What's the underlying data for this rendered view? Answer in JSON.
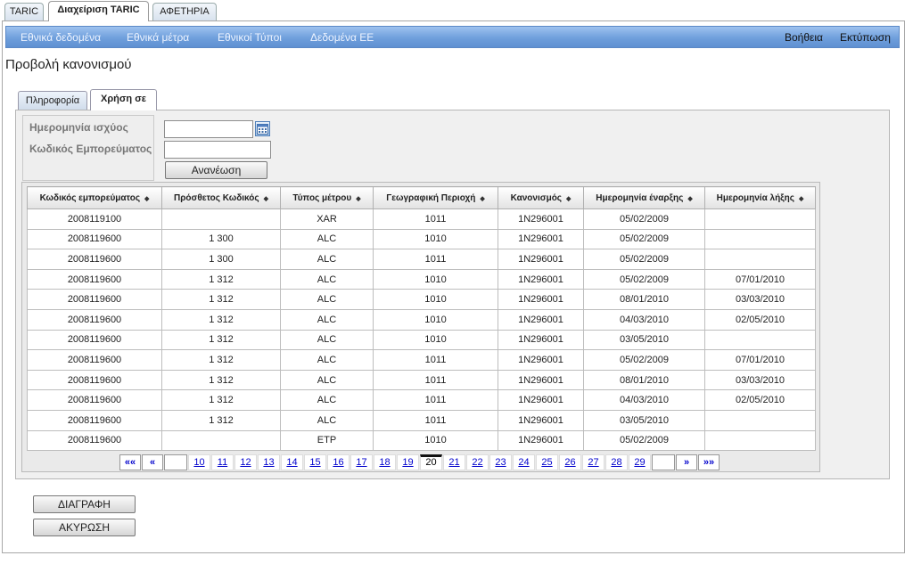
{
  "top_tabs": [
    {
      "label": "TARIC",
      "active": false
    },
    {
      "label": "Διαχείριση TARIC",
      "active": true
    },
    {
      "label": "ΑΦΕΤΗΡΙΑ",
      "active": false
    }
  ],
  "navbar": {
    "left": [
      "Εθνικά δεδομένα",
      "Εθνικά μέτρα",
      "Εθνικοί Τύποι",
      "Δεδομένα ΕΕ"
    ],
    "right": [
      "Βοήθεια",
      "Εκτύπωση"
    ]
  },
  "page_title": "Προβολή κανονισμού",
  "inner_tabs": [
    {
      "label": "Πληροφορία",
      "active": false
    },
    {
      "label": "Χρήση σε",
      "active": true
    }
  ],
  "filter": {
    "date_label": "Ημερομηνία ισχύος",
    "date_value": "",
    "code_label": "Κωδικός Εμπορεύματος",
    "code_value": "",
    "refresh_label": "Ανανέωση",
    "calendar_icon": "calendar-icon"
  },
  "table": {
    "headers": [
      "Κωδικός εμπορεύματος",
      "Πρόσθετος Κωδικός",
      "Τύπος μέτρου",
      "Γεωγραφική Περιοχή",
      "Κανονισμός",
      "Ημερομηνία έναρξης",
      "Ημερομηνία λήξης"
    ],
    "rows": [
      [
        "2008119100",
        "",
        "XAR",
        "1011",
        "1N296001",
        "05/02/2009",
        ""
      ],
      [
        "2008119600",
        "1 300",
        "ALC",
        "1010",
        "1N296001",
        "05/02/2009",
        ""
      ],
      [
        "2008119600",
        "1 300",
        "ALC",
        "1011",
        "1N296001",
        "05/02/2009",
        ""
      ],
      [
        "2008119600",
        "1 312",
        "ALC",
        "1010",
        "1N296001",
        "05/02/2009",
        "07/01/2010"
      ],
      [
        "2008119600",
        "1 312",
        "ALC",
        "1010",
        "1N296001",
        "08/01/2010",
        "03/03/2010"
      ],
      [
        "2008119600",
        "1 312",
        "ALC",
        "1010",
        "1N296001",
        "04/03/2010",
        "02/05/2010"
      ],
      [
        "2008119600",
        "1 312",
        "ALC",
        "1010",
        "1N296001",
        "03/05/2010",
        ""
      ],
      [
        "2008119600",
        "1 312",
        "ALC",
        "1011",
        "1N296001",
        "05/02/2009",
        "07/01/2010"
      ],
      [
        "2008119600",
        "1 312",
        "ALC",
        "1011",
        "1N296001",
        "08/01/2010",
        "03/03/2010"
      ],
      [
        "2008119600",
        "1 312",
        "ALC",
        "1011",
        "1N296001",
        "04/03/2010",
        "02/05/2010"
      ],
      [
        "2008119600",
        "1 312",
        "ALC",
        "1011",
        "1N296001",
        "03/05/2010",
        ""
      ],
      [
        "2008119600",
        "",
        "ETP",
        "1010",
        "1N296001",
        "05/02/2009",
        ""
      ]
    ]
  },
  "pagination": {
    "first": "««",
    "prev": "«",
    "next": "»",
    "last": "»»",
    "pages": [
      "10",
      "11",
      "12",
      "13",
      "14",
      "15",
      "16",
      "17",
      "18",
      "19",
      "20",
      "21",
      "22",
      "23",
      "24",
      "25",
      "26",
      "27",
      "28",
      "29"
    ],
    "current": "20"
  },
  "actions": {
    "delete_label": "ΔΙΑΓΡΑΦΗ",
    "cancel_label": "ΑΚΥΡΩΣΗ"
  }
}
